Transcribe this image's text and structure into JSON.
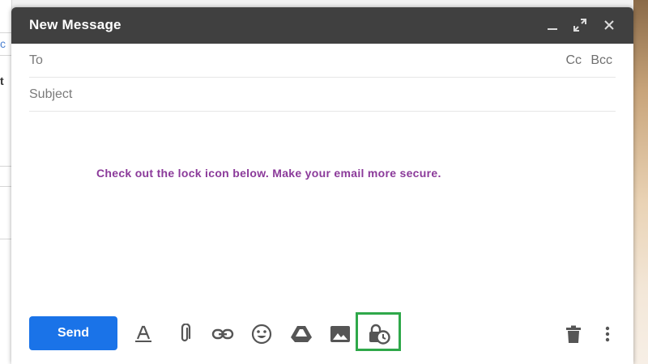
{
  "compose": {
    "title": "New Message",
    "to_label": "To",
    "cc_label": "Cc",
    "bcc_label": "Bcc",
    "subject_placeholder": "Subject",
    "body_text": "Check out the lock icon below. Make your email more secure.",
    "send_label": "Send"
  },
  "colors": {
    "titlebar": "#404040",
    "send_button": "#1a73e8",
    "body_text": "#8b3a9a",
    "highlight_box": "#2fa84a"
  },
  "toolbar_icons": [
    "formatting-icon",
    "attach-file-icon",
    "insert-link-icon",
    "emoji-icon",
    "google-drive-icon",
    "insert-photo-icon",
    "confidential-mode-icon",
    "discard-draft-icon",
    "more-options-icon"
  ],
  "background": {
    "fragment_top": "c",
    "fragment_mid": "t"
  }
}
